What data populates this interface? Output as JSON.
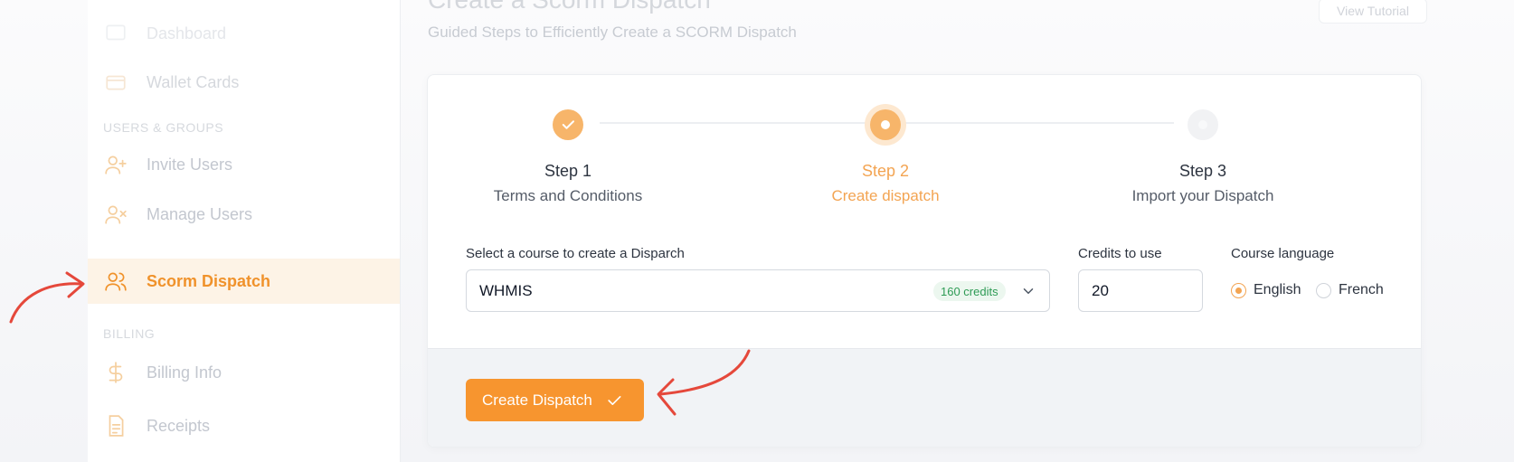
{
  "header": {
    "title": "Create a Scorm Dispatch",
    "subtitle": "Guided Steps to Efficiently Create a SCORM Dispatch",
    "tutorial_button": "View Tutorial"
  },
  "sidebar": {
    "items_top": [
      {
        "label": "Dashboard",
        "icon": "dashboard-icon"
      },
      {
        "label": "Wallet Cards",
        "icon": "wallet-icon"
      }
    ],
    "section_users": "USERS & GROUPS",
    "items_users": [
      {
        "label": "Invite Users",
        "icon": "user-plus-icon"
      },
      {
        "label": "Manage Users",
        "icon": "user-x-icon"
      },
      {
        "label": "Scorm Dispatch",
        "icon": "users-icon",
        "active": true
      }
    ],
    "section_billing": "BILLING",
    "items_billing": [
      {
        "label": "Billing Info",
        "icon": "dollar-icon"
      },
      {
        "label": "Receipts",
        "icon": "receipt-icon"
      }
    ]
  },
  "stepper": {
    "steps": [
      {
        "title": "Step 1",
        "subtitle": "Terms and Conditions",
        "state": "done"
      },
      {
        "title": "Step 2",
        "subtitle": "Create dispatch",
        "state": "current"
      },
      {
        "title": "Step 3",
        "subtitle": "Import your Dispatch",
        "state": "upcoming"
      }
    ]
  },
  "form": {
    "course_label": "Select a course to create a Disparch",
    "course_value": "WHMIS",
    "course_credits": "160 credits",
    "credits_label": "Credits to use",
    "credits_value": "20",
    "language_label": "Course language",
    "languages": [
      {
        "label": "English",
        "checked": true
      },
      {
        "label": "French",
        "checked": false
      }
    ]
  },
  "footer": {
    "create_button": "Create Dispatch"
  },
  "colors": {
    "accent": "#f7952f",
    "accent_light": "#fdf3e6",
    "success": "#2e9b55",
    "annotation_arrow": "#e5483b"
  }
}
